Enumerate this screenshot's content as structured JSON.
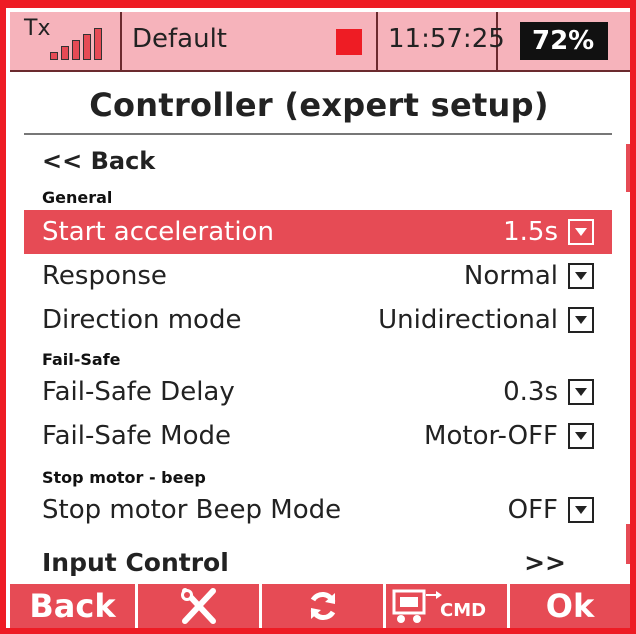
{
  "status": {
    "tx_label": "Tx",
    "model_name": "Default",
    "time": "11:57:25",
    "battery": "72%",
    "battery_level": 0.72,
    "signal_bars": 5,
    "accent": "#e64b55"
  },
  "title": "Controller (expert setup)",
  "back_label": "<<  Back",
  "sections": {
    "general": "General",
    "failsafe": "Fail-Safe",
    "stopmotor": "Stop motor - beep"
  },
  "items": [
    {
      "label": "Start acceleration",
      "value": "1.5s"
    },
    {
      "label": "Response",
      "value": "Normal"
    },
    {
      "label": "Direction mode",
      "value": "Unidirectional"
    },
    {
      "label": "Fail-Safe Delay",
      "value": "0.3s"
    },
    {
      "label": "Fail-Safe Mode",
      "value": "Motor-OFF"
    },
    {
      "label": "Stop motor Beep Mode",
      "value": "OFF"
    }
  ],
  "input_control": {
    "label": "Input Control",
    "arrow": ">>"
  },
  "footer": {
    "back": "Back",
    "tools_icon": "wrench-screwdriver-icon",
    "refresh_icon": "refresh-icon",
    "cmd_icon": "receiver-cmd-icon",
    "cmd_text": "CMD",
    "ok": "Ok"
  }
}
